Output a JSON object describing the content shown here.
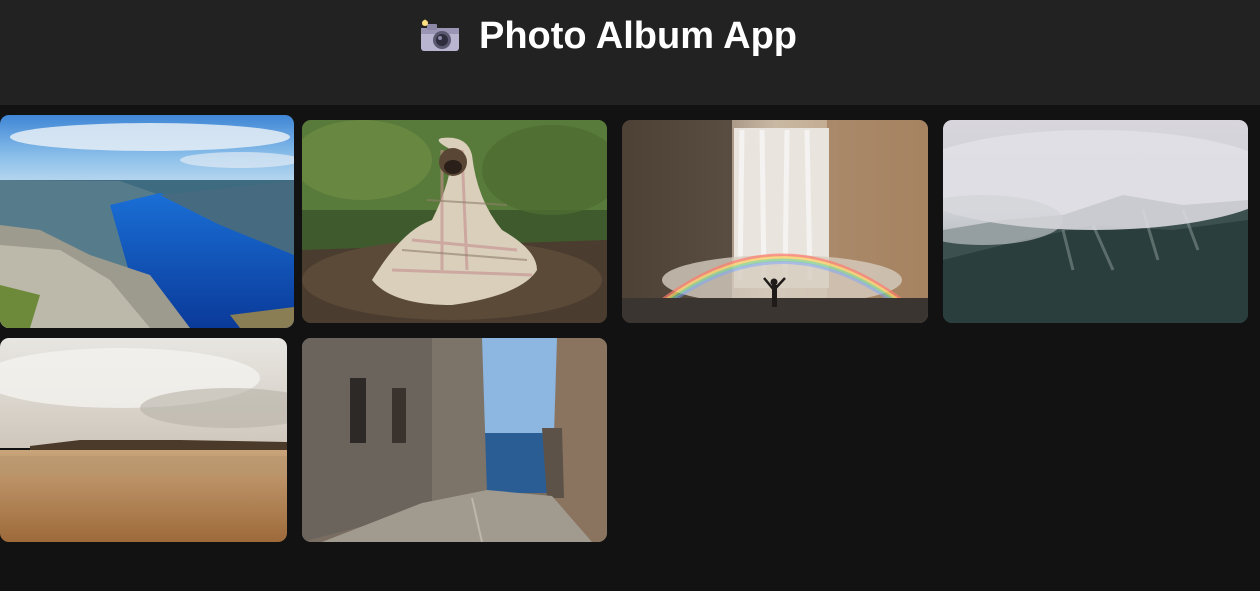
{
  "app": {
    "title": "Photo Album App",
    "icon": "camera-with-flash-icon"
  },
  "colors": {
    "header_bg": "#222222",
    "page_bg": "#121212",
    "title_text": "#ffffff"
  },
  "photos": [
    {
      "subject": "fjord-landscape"
    },
    {
      "subject": "pug-in-blanket"
    },
    {
      "subject": "waterfall-rainbow"
    },
    {
      "subject": "misty-mountains"
    },
    {
      "subject": "sepia-beach"
    },
    {
      "subject": "narrow-alley-sea"
    }
  ]
}
